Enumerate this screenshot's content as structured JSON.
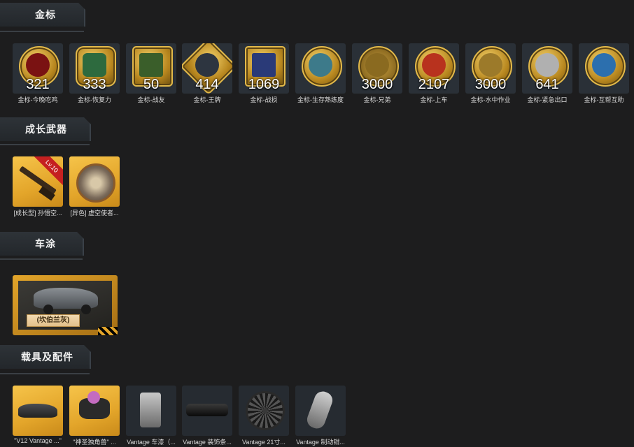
{
  "sections": {
    "gold": {
      "title": "金标"
    },
    "weapons": {
      "title": "成长武器"
    },
    "skins": {
      "title": "车涂"
    },
    "vehicles": {
      "title": "载具及配件"
    }
  },
  "gold_badges": [
    {
      "count": "321",
      "label": "金标-今晚吃鸡"
    },
    {
      "count": "333",
      "label": "金标-恢复力"
    },
    {
      "count": "50",
      "label": "金标-战友"
    },
    {
      "count": "414",
      "label": "金标-王牌"
    },
    {
      "count": "1069",
      "label": "金标-战损"
    },
    {
      "count": "",
      "label": "金标-生存熟练度"
    },
    {
      "count": "3000",
      "label": "金标-兄弟"
    },
    {
      "count": "2107",
      "label": "金标-上车"
    },
    {
      "count": "3000",
      "label": "金标-水中作业"
    },
    {
      "count": "641",
      "label": "金标-紧急出口"
    },
    {
      "count": "",
      "label": "金标-互帮互助"
    }
  ],
  "weapons": [
    {
      "label": "[成长型] 孙悟空...",
      "level": "Lv.10"
    },
    {
      "label": "[异色] 虚空使者..."
    }
  ],
  "skin": {
    "tag": "(坎伯兰灰)"
  },
  "vehicles": [
    {
      "label": "\"V12 Vantage ...\""
    },
    {
      "label": "\"神圣独角兽\" ..."
    },
    {
      "label": "Vantage 车漆（..."
    },
    {
      "label": "Vantage 装饰条..."
    },
    {
      "label": "Vantage 21寸..."
    },
    {
      "label": "Vantage 制动钳..."
    }
  ]
}
